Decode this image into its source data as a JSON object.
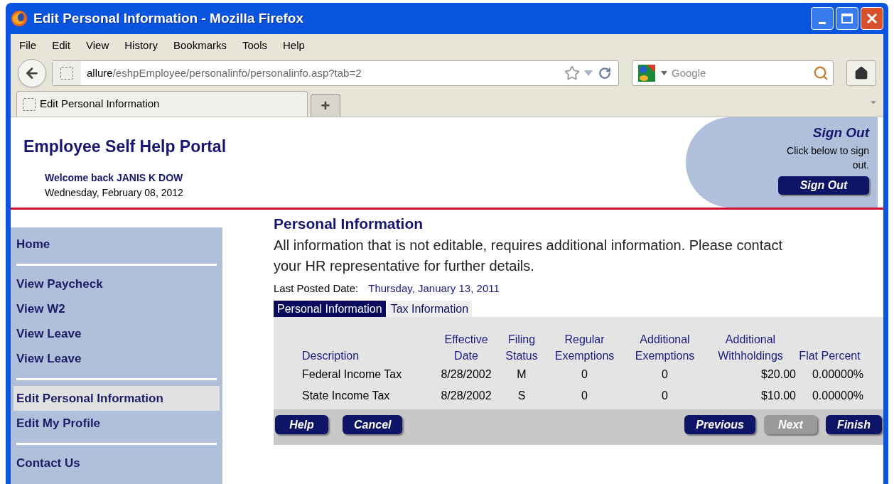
{
  "window": {
    "title": "Edit Personal Information - Mozilla Firefox"
  },
  "menu": [
    "File",
    "Edit",
    "View",
    "History",
    "Bookmarks",
    "Tools",
    "Help"
  ],
  "address": {
    "host": "allure",
    "path": "/eshpEmployee/personalinfo/personalinfo.asp?tab=2"
  },
  "search": {
    "placeholder": "Google"
  },
  "browser_tabs": [
    {
      "label": "Edit Personal Information",
      "selected": true
    }
  ],
  "new_tab": "+",
  "header": {
    "title": "Employee Self Help Portal",
    "welcome": "Welcome back JANIS K DOW",
    "date": "Wednesday, February 08, 2012",
    "signout_title": "Sign Out",
    "signout_hint": "Click below to sign out.",
    "signout_button": "Sign Out"
  },
  "sidebar": {
    "groups": [
      {
        "items": [
          {
            "label": "Home",
            "selected": false
          }
        ]
      },
      {
        "items": [
          {
            "label": "View Paycheck",
            "selected": false
          },
          {
            "label": "View W2",
            "selected": false
          },
          {
            "label": "View Leave",
            "selected": false
          },
          {
            "label": "View Leave",
            "selected": false
          }
        ]
      },
      {
        "items": [
          {
            "label": "Edit Personal Information",
            "selected": true
          },
          {
            "label": "Edit My Profile",
            "selected": false
          }
        ]
      },
      {
        "items": [
          {
            "label": "Contact Us",
            "selected": false
          }
        ]
      }
    ]
  },
  "content": {
    "title": "Personal Information",
    "notice": "All information that is not editable, requires additional information. Please contact your HR representative for further details.",
    "last_posted_label": "Last Posted Date:",
    "last_posted_value": "Thursday, January 13, 2011",
    "tabs": [
      {
        "label": "Personal Information",
        "selected": true
      },
      {
        "label": "Tax Information",
        "selected": false
      }
    ],
    "table": {
      "columns": [
        "Description",
        "Effective Date",
        "Filing Status",
        "Regular Exemptions",
        "Additional Exemptions",
        "Additional Withholdings",
        "Flat Percent"
      ],
      "rows": [
        [
          "Federal Income Tax",
          "8/28/2002",
          "M",
          "0",
          "0",
          "$20.00",
          "0.00000%"
        ],
        [
          "State Income Tax",
          "8/28/2002",
          "S",
          "0",
          "0",
          "$10.00",
          "0.00000%"
        ]
      ]
    },
    "buttons_left": [
      {
        "label": "Help",
        "disabled": false
      },
      {
        "label": "Cancel",
        "disabled": false
      }
    ],
    "buttons_right": [
      {
        "label": "Previous",
        "disabled": false
      },
      {
        "label": "Next",
        "disabled": true
      },
      {
        "label": "Finish",
        "disabled": false
      }
    ]
  }
}
